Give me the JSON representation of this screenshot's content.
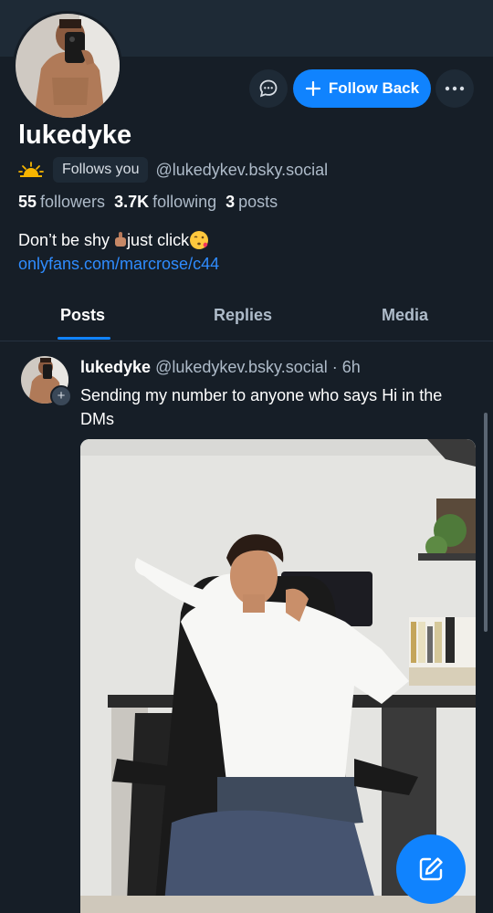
{
  "profile": {
    "display_name": "lukedyke",
    "follows_you": "Follows you",
    "handle": "@lukedykev.bsky.social",
    "stats": {
      "followers_count": "55",
      "followers_label": "followers",
      "following_count": "3.7K",
      "following_label": "following",
      "posts_count": "3",
      "posts_label": "posts"
    },
    "bio_text_1": "Don’t be shy ",
    "bio_text_2": "just click",
    "bio_link": "onlyfans.com/marcrose/c44"
  },
  "actions": {
    "follow_back_label": "Follow Back"
  },
  "tabs": [
    {
      "label": "Posts",
      "active": true
    },
    {
      "label": "Replies",
      "active": false
    },
    {
      "label": "Media",
      "active": false
    }
  ],
  "post": {
    "author_name": "lukedyke",
    "author_handle": "@lukedykev.bsky.social",
    "separator": " · ",
    "time": "6h",
    "text": "Sending my number to anyone who says Hi in the DMs"
  },
  "colors": {
    "background": "#161e27",
    "accent": "#1083fe",
    "muted_text": "#aebbc9",
    "link": "#2f8cff"
  },
  "icons": [
    "chat-bubble-icon",
    "plus-icon",
    "more-icon",
    "sunrise-emoji",
    "pointing-down-emoji",
    "kiss-emoji",
    "compose-icon"
  ]
}
